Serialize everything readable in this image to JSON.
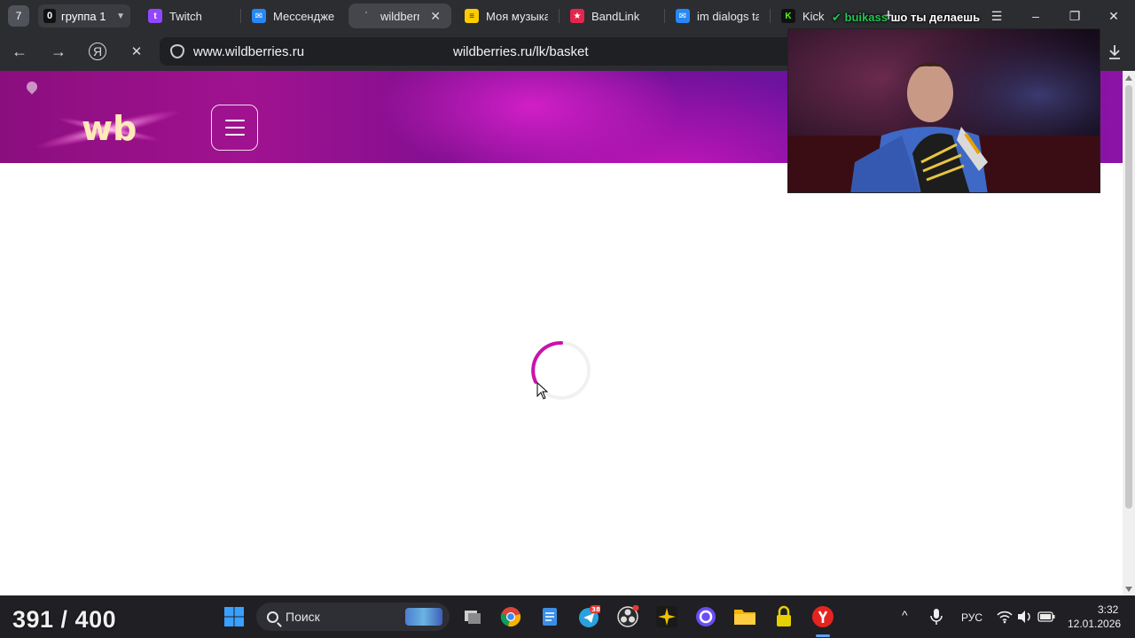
{
  "tabbar": {
    "tab_count": "7",
    "group": {
      "badge": "0",
      "label": "группа 1"
    },
    "tabs": [
      {
        "label": "Twitch",
        "favicon_color": "#9146ff",
        "icon": "twitch-icon"
      },
      {
        "label": "Мессендже",
        "favicon_color": "#2787f5",
        "icon": "messenger-icon"
      },
      {
        "label": "wildberrie",
        "favicon_color": "#44464c",
        "icon": "loading-icon",
        "active": true,
        "close": "✕"
      },
      {
        "label": "Моя музыка",
        "favicon_color": "#ffcc00",
        "icon": "music-icon"
      },
      {
        "label": "BandLink",
        "favicon_color": "#e6254d",
        "icon": "bandlink-icon"
      },
      {
        "label": "im dialogs ta",
        "favicon_color": "#2787f5",
        "icon": "messenger-icon"
      },
      {
        "label": "Kick",
        "favicon_color": "#53fc18",
        "icon": "kick-icon"
      }
    ],
    "window_controls": {
      "menu": "☰",
      "minimize": "–",
      "restore": "❐",
      "close": "✕"
    }
  },
  "toolbar": {
    "back": "←",
    "forward": "→",
    "yandex": "Я",
    "stop": "✕",
    "host": "www.wildberries.ru",
    "path": "wildberries.ru/lk/basket"
  },
  "page": {
    "logo_text": "wb",
    "colors": {
      "header_start": "#8b0e7e",
      "header_end": "#8c13a6",
      "spinner": "#cb11ab"
    }
  },
  "webcam": {
    "prefix": "✔",
    "user": "buikass",
    "message": "шо ты делаешь"
  },
  "taskbar": {
    "counter": "391 / 400",
    "search_placeholder": "Поиск",
    "apps": [
      {
        "name": "windows-start-icon",
        "color": "#3aa0ff"
      },
      {
        "name": "task-view-icon",
        "color": "#cfcfcf"
      },
      {
        "name": "chrome-icon",
        "color": "#1da462"
      },
      {
        "name": "notepad-icon",
        "color": "#3a8ee6"
      },
      {
        "name": "telegram-icon",
        "color": "#2aa1da",
        "badge": "38"
      },
      {
        "name": "obs-icon",
        "color": "#3a3a3a"
      },
      {
        "name": "app-sparkle-icon",
        "color": "#f2c200"
      },
      {
        "name": "app-circle-icon",
        "color": "#6b4df5"
      },
      {
        "name": "file-explorer-icon",
        "color": "#f4b400"
      },
      {
        "name": "lock-app-icon",
        "color": "#e6d000"
      },
      {
        "name": "yandex-browser-icon",
        "color": "#e52420"
      }
    ],
    "tray": {
      "chevron": "^",
      "language": "РУС",
      "time": "3:32",
      "date": "12.01.2026"
    }
  }
}
